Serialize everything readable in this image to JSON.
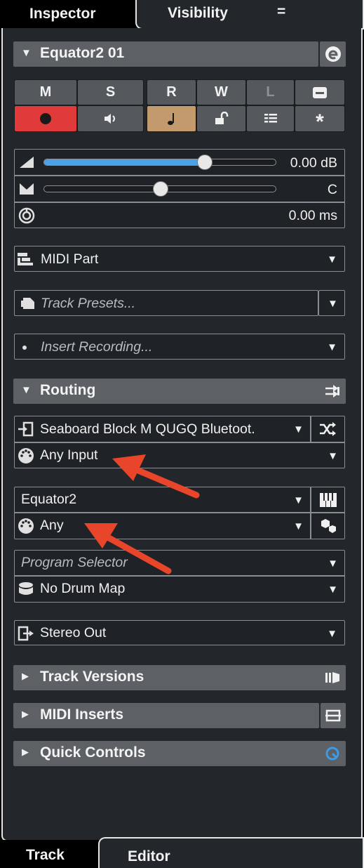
{
  "tabs": {
    "inspector": "Inspector",
    "visibility": "Visibility",
    "menu": "="
  },
  "bottom_tabs": {
    "track": "Track",
    "editor": "Editor"
  },
  "track_header": {
    "title": "Equator2 01",
    "edit_icon": "e-icon"
  },
  "buttons_top": {
    "m": "M",
    "s": "S",
    "r": "R",
    "w": "W",
    "l": "L"
  },
  "volume": {
    "value": "0.00 dB",
    "fill_fraction": 0.69
  },
  "pan": {
    "value": "C",
    "position_fraction": 0.5
  },
  "delay": {
    "value": "0.00 ms"
  },
  "midi_part": {
    "label": "MIDI Part"
  },
  "track_presets": {
    "label": "Track Presets..."
  },
  "insert_recording": {
    "label": "Insert Recording..."
  },
  "routing": {
    "title": "Routing",
    "input": "Seaboard Block M QUGQ Bluetoot.",
    "input_channel": "Any Input",
    "output": "Equator2",
    "output_channel": "Any",
    "program_selector": "Program Selector",
    "drum_map": "No Drum Map"
  },
  "audio_output": {
    "label": "Stereo Out"
  },
  "sections": {
    "track_versions": "Track Versions",
    "midi_inserts": "MIDI Inserts",
    "quick_controls": "Quick Controls"
  },
  "colors": {
    "record": "#e03a3a",
    "monitor_active": "#c39a6d",
    "slider": "#4aa3e8",
    "arrow": "#e8452a",
    "quick_control_icon": "#3b9be8"
  }
}
